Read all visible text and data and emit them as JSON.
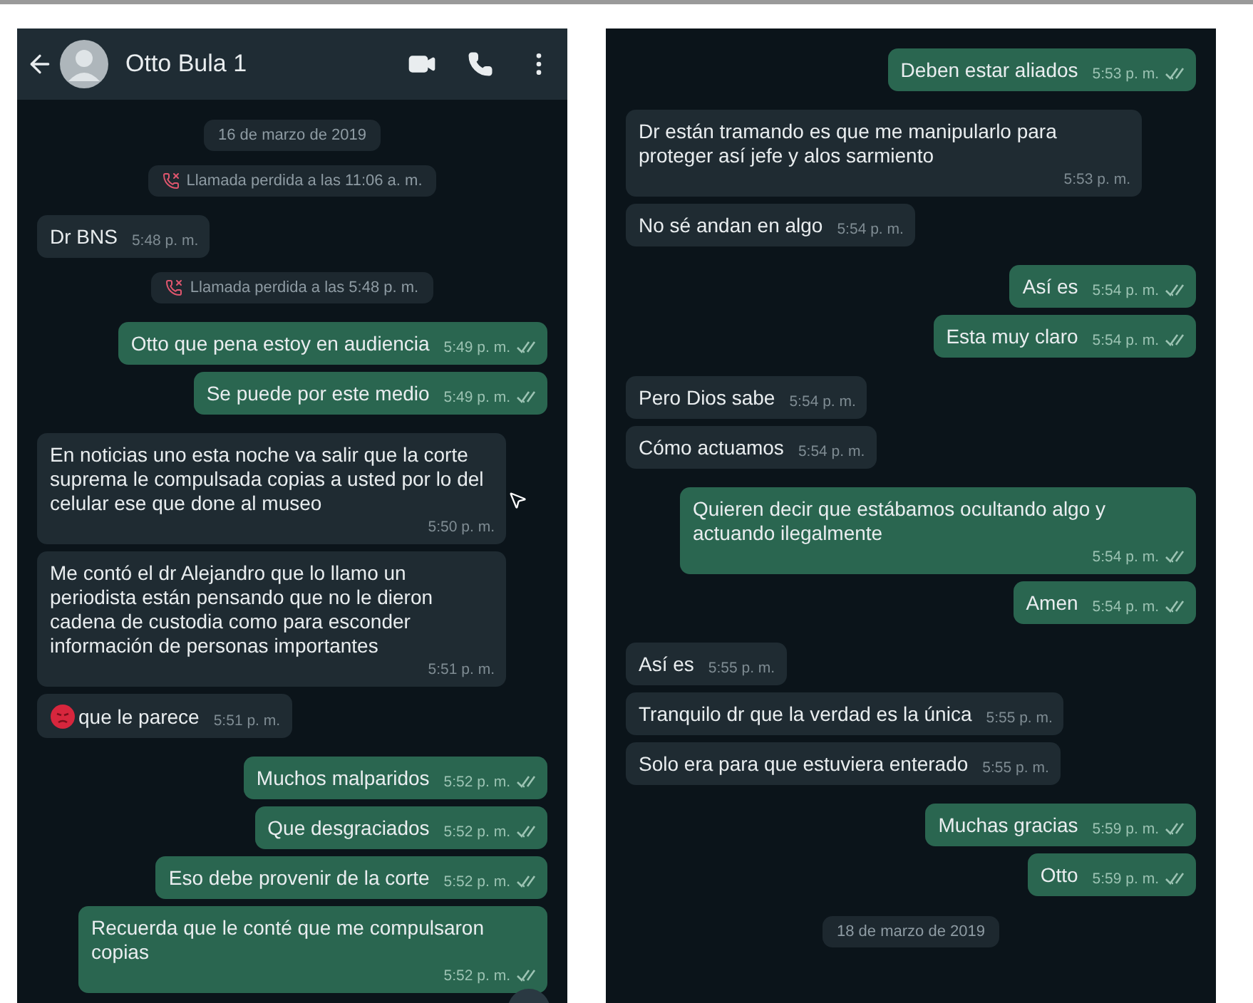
{
  "left_chat": {
    "header": {
      "contact_name": "Otto Bula 1"
    },
    "messages": [
      {
        "kind": "date",
        "text": "16 de marzo de 2019"
      },
      {
        "kind": "missed_call",
        "text": "Llamada perdida a las 11:06 a. m."
      },
      {
        "kind": "in",
        "text": "Dr BNS",
        "time": "5:48 p. m."
      },
      {
        "kind": "missed_call",
        "text": "Llamada perdida a las 5:48 p. m."
      },
      {
        "kind": "out",
        "text": "Otto que pena estoy en audiencia",
        "time": "5:49 p. m."
      },
      {
        "kind": "out",
        "text": "Se puede por este medio",
        "time": "5:49 p. m."
      },
      {
        "kind": "in",
        "text": "En noticias uno esta noche va salir que la corte suprema le compulsada copias a usted por lo del celular ese que done al museo",
        "time": "5:50 p. m."
      },
      {
        "kind": "in",
        "text": "Me contó el dr Alejandro que lo llamo un periodista están pensando que no le dieron cadena de custodia como para esconder información de personas importantes",
        "time": "5:51 p. m."
      },
      {
        "kind": "in",
        "emoji": true,
        "text": "que le parece",
        "time": "5:51 p. m."
      },
      {
        "kind": "out",
        "text": "Muchos malparidos",
        "time": "5:52 p. m."
      },
      {
        "kind": "out",
        "text": "Que desgraciados",
        "time": "5:52 p. m."
      },
      {
        "kind": "out",
        "text": "Eso debe provenir de la corte",
        "time": "5:52 p. m."
      },
      {
        "kind": "out",
        "text": "Recuerda que le conté que me compulsaron copias",
        "time": "5:52 p. m."
      }
    ]
  },
  "right_chat": {
    "messages": [
      {
        "kind": "out",
        "text": "Deben estar aliados",
        "time": "5:53 p. m."
      },
      {
        "kind": "in",
        "text": "Dr están tramando es que me manipularlo para proteger así jefe y alos sarmiento",
        "time": "5:53 p. m."
      },
      {
        "kind": "in",
        "text": "No sé andan en algo",
        "time": "5:54 p. m."
      },
      {
        "kind": "out",
        "text": "Así es",
        "time": "5:54 p. m."
      },
      {
        "kind": "out",
        "text": "Esta muy claro",
        "time": "5:54 p. m."
      },
      {
        "kind": "in",
        "text": "Pero Dios sabe",
        "time": "5:54 p. m."
      },
      {
        "kind": "in",
        "text": "Cómo actuamos",
        "time": "5:54 p. m."
      },
      {
        "kind": "out",
        "text": "Quieren decir que estábamos ocultando algo y actuando ilegalmente",
        "time": "5:54 p. m."
      },
      {
        "kind": "out",
        "text": "Amen",
        "time": "5:54 p. m."
      },
      {
        "kind": "in",
        "text": "Así es",
        "time": "5:55 p. m."
      },
      {
        "kind": "in",
        "text": "Tranquilo dr que la verdad es la única",
        "time": "5:55 p. m."
      },
      {
        "kind": "in",
        "text": "Solo era para que estuviera enterado",
        "time": "5:55 p. m."
      },
      {
        "kind": "out",
        "text": "Muchas gracias",
        "time": "5:59 p. m."
      },
      {
        "kind": "out",
        "text": "Otto",
        "time": "5:59 p. m."
      },
      {
        "kind": "date",
        "text": "18 de marzo de 2019"
      }
    ]
  }
}
